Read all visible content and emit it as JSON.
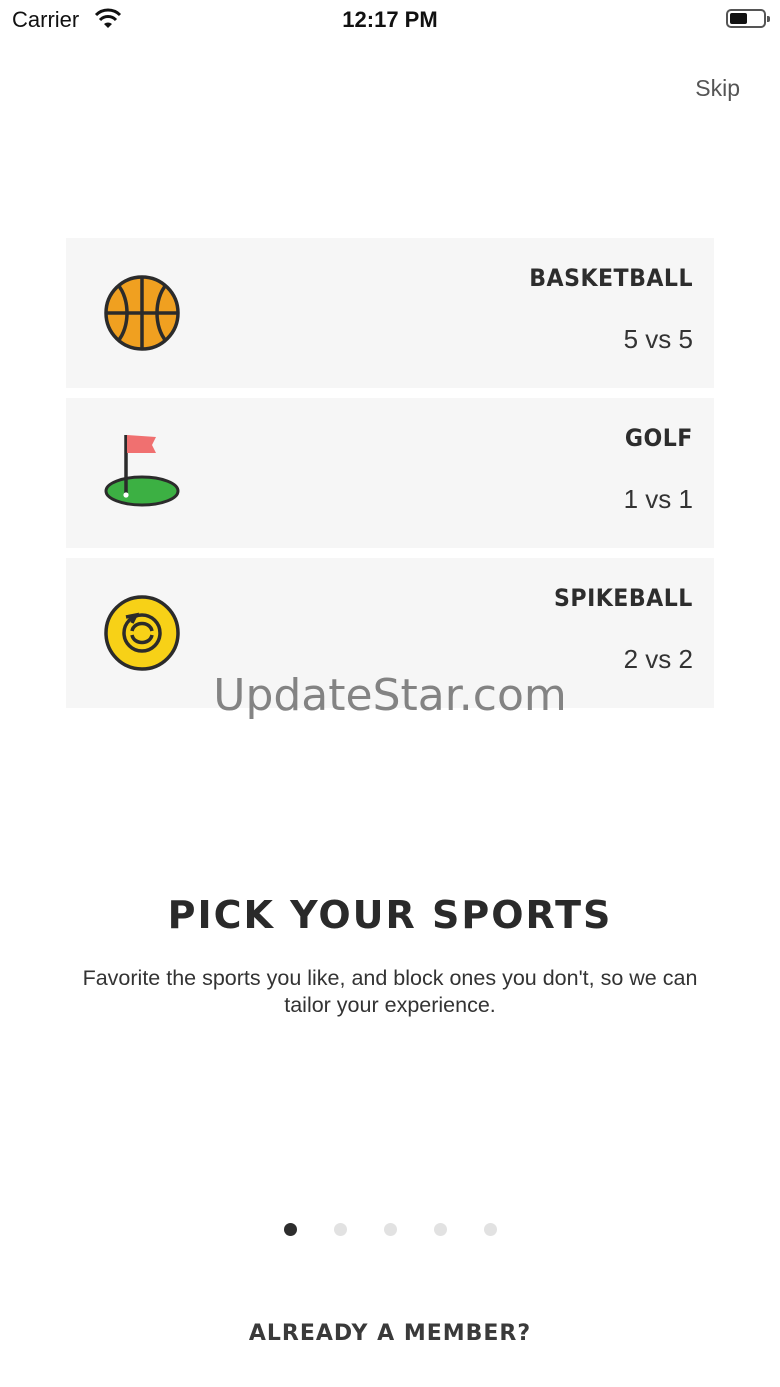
{
  "status_bar": {
    "carrier": "Carrier",
    "time": "12:17 PM"
  },
  "skip_label": "Skip",
  "sports": [
    {
      "name": "BASKETBALL",
      "format": "5 vs 5",
      "icon": "basketball-icon"
    },
    {
      "name": "GOLF",
      "format": "1 vs 1",
      "icon": "golf-flag-icon"
    },
    {
      "name": "SPIKEBALL",
      "format": "2 vs 2",
      "icon": "spikeball-icon"
    }
  ],
  "watermark": "UpdateStar.com",
  "onboarding": {
    "heading": "PICK YOUR SPORTS",
    "description": "Favorite the sports you like, and block ones you don't, so we can tailor your experience."
  },
  "pagination": {
    "total": 5,
    "current": 1
  },
  "member_link": "ALREADY A MEMBER?",
  "colors": {
    "basketball": "#f0a020",
    "golf_green": "#3cb043",
    "golf_flag": "#f07070",
    "spikeball": "#f7d117"
  }
}
